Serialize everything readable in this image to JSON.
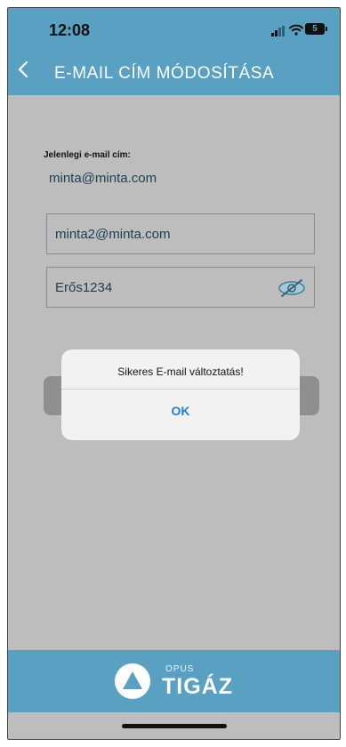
{
  "status_bar": {
    "time": "12:08",
    "battery": "5"
  },
  "header": {
    "title": "E-MAIL CÍM MÓDOSÍTÁSA"
  },
  "form": {
    "current_email_label": "Jelenlegi e-mail cím:",
    "current_email_value": "minta@minta.com",
    "new_email_value": "minta2@minta.com",
    "password_value": "Erős1234"
  },
  "dialog": {
    "message": "Sikeres E-mail változtatás!",
    "ok_label": "OK"
  },
  "footer": {
    "brand_small": "OPUS",
    "brand_large": "TIGÁZ"
  },
  "icons": [
    "signal-icon",
    "wifi-icon",
    "battery-icon",
    "back-icon",
    "eye-slash-icon",
    "logo-icon"
  ],
  "colors": {
    "brand_blue": "#5aa0c3",
    "dialog_ok": "#1c7fd6"
  }
}
